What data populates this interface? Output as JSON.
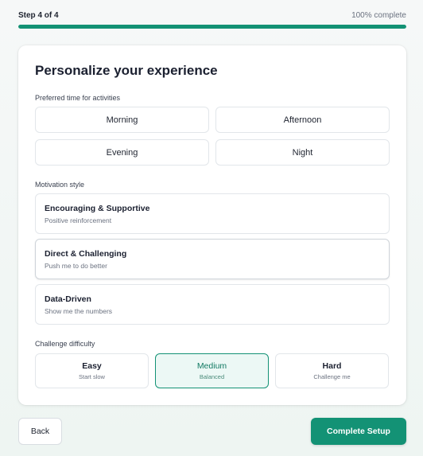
{
  "progress": {
    "step_text": "Step 4 of 4",
    "percent_text": "100% complete",
    "fraction": 1.0
  },
  "colors": {
    "accent": "#139275",
    "selected_bg": "#ecf8f5"
  },
  "card": {
    "title": "Personalize your experience",
    "time": {
      "label": "Preferred time for activities",
      "options": [
        "Morning",
        "Afternoon",
        "Evening",
        "Night"
      ]
    },
    "motivation": {
      "label": "Motivation style",
      "options": [
        {
          "title": "Encouraging & Supportive",
          "subtitle": "Positive reinforcement"
        },
        {
          "title": "Direct & Challenging",
          "subtitle": "Push me to do better"
        },
        {
          "title": "Data-Driven",
          "subtitle": "Show me the numbers"
        }
      ]
    },
    "difficulty": {
      "label": "Challenge difficulty",
      "selected": "Medium",
      "options": [
        {
          "title": "Easy",
          "subtitle": "Start slow"
        },
        {
          "title": "Medium",
          "subtitle": "Balanced"
        },
        {
          "title": "Hard",
          "subtitle": "Challenge me"
        }
      ]
    }
  },
  "footer": {
    "back_label": "Back",
    "complete_label": "Complete Setup"
  }
}
